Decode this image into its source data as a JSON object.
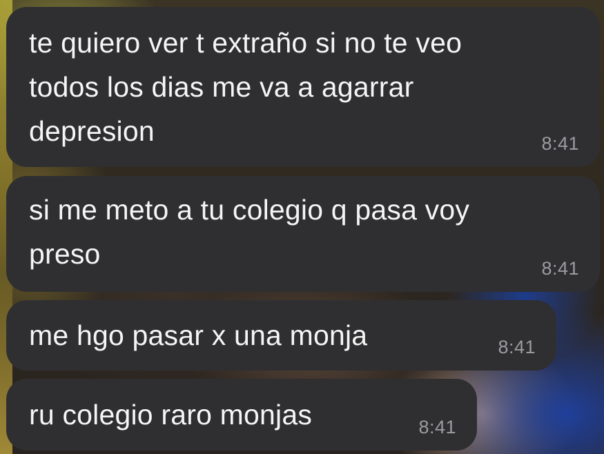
{
  "messages": [
    {
      "text": "te quiero ver t extraño si no te veo\ntodos los dias me va a agarrar\ndepresion",
      "time": "8:41"
    },
    {
      "text": "si me meto a tu colegio q pasa voy\npreso",
      "time": "8:41"
    },
    {
      "text": "me hgo pasar x una monja",
      "time": "8:41"
    },
    {
      "text": "ru colegio raro monjas",
      "time": "8:41"
    }
  ],
  "colors": {
    "bubble_background": "#2f2f31",
    "message_text": "#f5f5f5",
    "timestamp_text": "#9c9ca0"
  }
}
